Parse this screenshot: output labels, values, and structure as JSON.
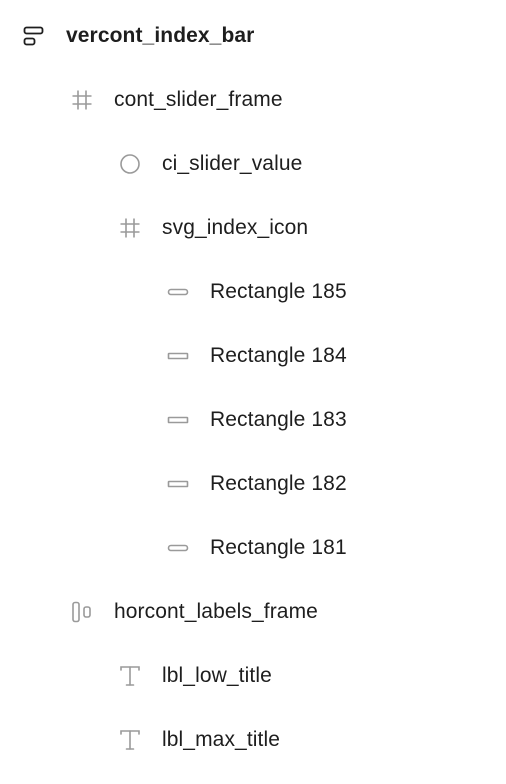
{
  "layers": [
    {
      "label": "vercont_index_bar",
      "icon": "vertical-autolayout-icon",
      "bold": true
    },
    {
      "label": "cont_slider_frame",
      "icon": "frame-icon"
    },
    {
      "label": "ci_slider_value",
      "icon": "ellipse-icon"
    },
    {
      "label": "svg_index_icon",
      "icon": "frame-icon"
    },
    {
      "label": "Rectangle 185",
      "icon": "rounded-rectangle-icon"
    },
    {
      "label": "Rectangle 184",
      "icon": "rectangle-icon"
    },
    {
      "label": "Rectangle 183",
      "icon": "rectangle-icon"
    },
    {
      "label": "Rectangle 182",
      "icon": "rectangle-icon"
    },
    {
      "label": "Rectangle 181",
      "icon": "rounded-rectangle-icon"
    },
    {
      "label": "horcont_labels_frame",
      "icon": "horizontal-autolayout-icon"
    },
    {
      "label": "lbl_low_title",
      "icon": "text-icon"
    },
    {
      "label": "lbl_max_title",
      "icon": "text-icon"
    }
  ]
}
